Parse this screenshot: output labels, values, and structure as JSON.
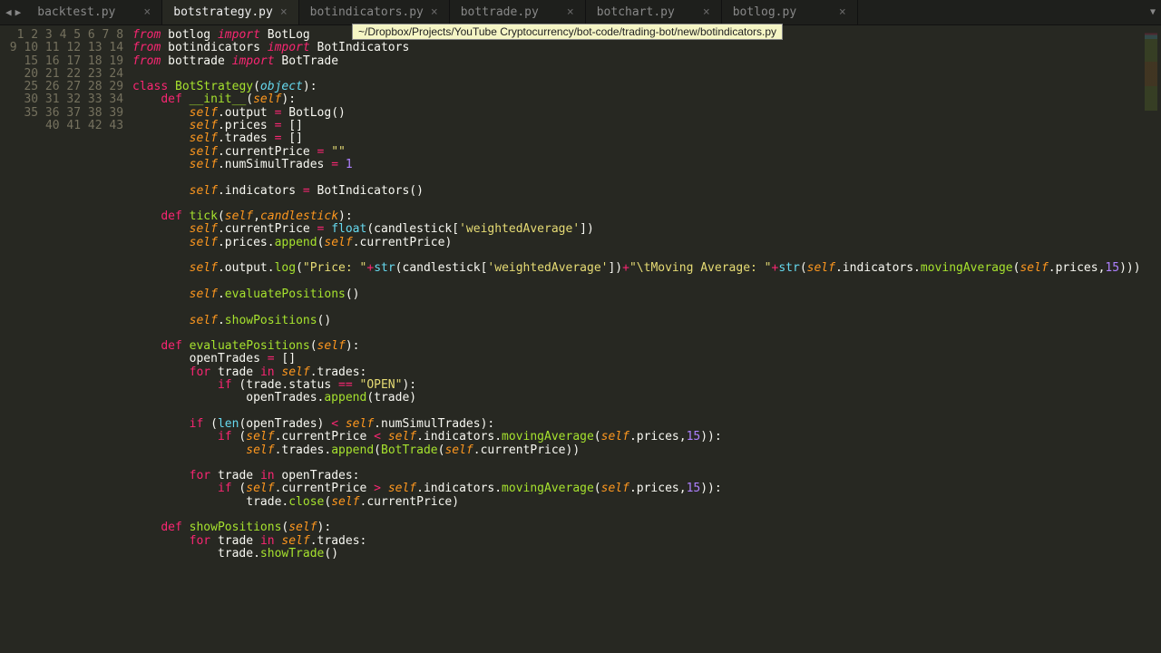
{
  "tabs": [
    {
      "label": "backtest.py",
      "active": false
    },
    {
      "label": "botstrategy.py",
      "active": true
    },
    {
      "label": "botindicators.py",
      "active": false
    },
    {
      "label": "bottrade.py",
      "active": false
    },
    {
      "label": "botchart.py",
      "active": false
    },
    {
      "label": "botlog.py",
      "active": false
    }
  ],
  "tooltip": "~/Dropbox/Projects/YouTube Cryptocurrency/bot-code/trading-bot/new/botindicators.py",
  "line_count": 43,
  "code_tokens": [
    [
      [
        "kw",
        "from"
      ],
      [
        "",
        ""
      ],
      [
        "ident",
        " botlog "
      ],
      [
        "kw",
        "import"
      ],
      [
        "ident",
        " BotLog"
      ]
    ],
    [
      [
        "kw",
        "from"
      ],
      [
        "ident",
        " botindicators "
      ],
      [
        "kw",
        "import"
      ],
      [
        "ident",
        " BotIndicators"
      ]
    ],
    [
      [
        "kw",
        "from"
      ],
      [
        "ident",
        " bottrade "
      ],
      [
        "kw",
        "import"
      ],
      [
        "ident",
        " BotTrade"
      ]
    ],
    [],
    [
      [
        "kw2",
        "class"
      ],
      [
        "ident",
        " "
      ],
      [
        "fn",
        "BotStrategy"
      ],
      [
        "ident",
        "("
      ],
      [
        "cls",
        "object"
      ],
      [
        "ident",
        "):"
      ]
    ],
    [
      [
        "ident",
        "    "
      ],
      [
        "kw2",
        "def"
      ],
      [
        "ident",
        " "
      ],
      [
        "fn",
        "__init__"
      ],
      [
        "ident",
        "("
      ],
      [
        "param",
        "self"
      ],
      [
        "ident",
        "):"
      ]
    ],
    [
      [
        "ident",
        "        "
      ],
      [
        "self",
        "self"
      ],
      [
        "ident",
        ".output "
      ],
      [
        "op",
        "="
      ],
      [
        "ident",
        " BotLog()"
      ]
    ],
    [
      [
        "ident",
        "        "
      ],
      [
        "self",
        "self"
      ],
      [
        "ident",
        ".prices "
      ],
      [
        "op",
        "="
      ],
      [
        "ident",
        " []"
      ]
    ],
    [
      [
        "ident",
        "        "
      ],
      [
        "self",
        "self"
      ],
      [
        "ident",
        ".trades "
      ],
      [
        "op",
        "="
      ],
      [
        "ident",
        " []"
      ]
    ],
    [
      [
        "ident",
        "        "
      ],
      [
        "self",
        "self"
      ],
      [
        "ident",
        ".currentPrice "
      ],
      [
        "op",
        "="
      ],
      [
        "ident",
        " "
      ],
      [
        "str",
        "\"\""
      ]
    ],
    [
      [
        "ident",
        "        "
      ],
      [
        "self",
        "self"
      ],
      [
        "ident",
        ".numSimulTrades "
      ],
      [
        "op",
        "="
      ],
      [
        "ident",
        " "
      ],
      [
        "num",
        "1"
      ]
    ],
    [],
    [
      [
        "ident",
        "        "
      ],
      [
        "self",
        "self"
      ],
      [
        "ident",
        ".indicators "
      ],
      [
        "op",
        "="
      ],
      [
        "ident",
        " BotIndicators()"
      ]
    ],
    [],
    [
      [
        "ident",
        "    "
      ],
      [
        "kw2",
        "def"
      ],
      [
        "ident",
        " "
      ],
      [
        "fn",
        "tick"
      ],
      [
        "ident",
        "("
      ],
      [
        "param",
        "self"
      ],
      [
        "ident",
        ","
      ],
      [
        "param",
        "candlestick"
      ],
      [
        "ident",
        "):"
      ]
    ],
    [
      [
        "ident",
        "        "
      ],
      [
        "self",
        "self"
      ],
      [
        "ident",
        ".currentPrice "
      ],
      [
        "op",
        "="
      ],
      [
        "ident",
        " "
      ],
      [
        "builtin",
        "float"
      ],
      [
        "ident",
        "(candlestick["
      ],
      [
        "str",
        "'weightedAverage'"
      ],
      [
        "ident",
        "])"
      ]
    ],
    [
      [
        "ident",
        "        "
      ],
      [
        "self",
        "self"
      ],
      [
        "ident",
        ".prices."
      ],
      [
        "fn",
        "append"
      ],
      [
        "ident",
        "("
      ],
      [
        "self",
        "self"
      ],
      [
        "ident",
        ".currentPrice)"
      ]
    ],
    [],
    [
      [
        "ident",
        "        "
      ],
      [
        "self",
        "self"
      ],
      [
        "ident",
        ".output."
      ],
      [
        "fn",
        "log"
      ],
      [
        "ident",
        "("
      ],
      [
        "str",
        "\"Price: \""
      ],
      [
        "op",
        "+"
      ],
      [
        "builtin",
        "str"
      ],
      [
        "ident",
        "(candlestick["
      ],
      [
        "str",
        "'weightedAverage'"
      ],
      [
        "ident",
        "])"
      ],
      [
        "op",
        "+"
      ],
      [
        "str",
        "\"\\tMoving Average: \""
      ],
      [
        "op",
        "+"
      ],
      [
        "builtin",
        "str"
      ],
      [
        "ident",
        "("
      ],
      [
        "self",
        "self"
      ],
      [
        "ident",
        ".indicators."
      ],
      [
        "fn",
        "movingAverage"
      ],
      [
        "ident",
        "("
      ],
      [
        "self",
        "self"
      ],
      [
        "ident",
        ".prices,"
      ],
      [
        "num",
        "15"
      ],
      [
        "ident",
        ")))"
      ]
    ],
    [],
    [
      [
        "ident",
        "        "
      ],
      [
        "self",
        "self"
      ],
      [
        "ident",
        "."
      ],
      [
        "fn",
        "evaluatePositions"
      ],
      [
        "ident",
        "()"
      ]
    ],
    [],
    [
      [
        "ident",
        "        "
      ],
      [
        "self",
        "self"
      ],
      [
        "ident",
        "."
      ],
      [
        "fn",
        "showPositions"
      ],
      [
        "ident",
        "()"
      ]
    ],
    [],
    [
      [
        "ident",
        "    "
      ],
      [
        "kw2",
        "def"
      ],
      [
        "ident",
        " "
      ],
      [
        "fn",
        "evaluatePositions"
      ],
      [
        "ident",
        "("
      ],
      [
        "param",
        "self"
      ],
      [
        "ident",
        "):"
      ]
    ],
    [
      [
        "ident",
        "        openTrades "
      ],
      [
        "op",
        "="
      ],
      [
        "ident",
        " []"
      ]
    ],
    [
      [
        "ident",
        "        "
      ],
      [
        "kw2",
        "for"
      ],
      [
        "ident",
        " trade "
      ],
      [
        "kw2",
        "in"
      ],
      [
        "ident",
        " "
      ],
      [
        "self",
        "self"
      ],
      [
        "ident",
        ".trades:"
      ]
    ],
    [
      [
        "ident",
        "            "
      ],
      [
        "kw2",
        "if"
      ],
      [
        "ident",
        " (trade.status "
      ],
      [
        "op",
        "=="
      ],
      [
        "ident",
        " "
      ],
      [
        "str",
        "\"OPEN\""
      ],
      [
        "ident",
        "):"
      ]
    ],
    [
      [
        "ident",
        "                openTrades."
      ],
      [
        "fn",
        "append"
      ],
      [
        "ident",
        "(trade)"
      ]
    ],
    [],
    [
      [
        "ident",
        "        "
      ],
      [
        "kw2",
        "if"
      ],
      [
        "ident",
        " ("
      ],
      [
        "builtin",
        "len"
      ],
      [
        "ident",
        "(openTrades) "
      ],
      [
        "op",
        "<"
      ],
      [
        "ident",
        " "
      ],
      [
        "self",
        "self"
      ],
      [
        "ident",
        ".numSimulTrades):"
      ]
    ],
    [
      [
        "ident",
        "            "
      ],
      [
        "kw2",
        "if"
      ],
      [
        "ident",
        " ("
      ],
      [
        "self",
        "self"
      ],
      [
        "ident",
        ".currentPrice "
      ],
      [
        "op",
        "<"
      ],
      [
        "ident",
        " "
      ],
      [
        "self",
        "self"
      ],
      [
        "ident",
        ".indicators."
      ],
      [
        "fn",
        "movingAverage"
      ],
      [
        "ident",
        "("
      ],
      [
        "self",
        "self"
      ],
      [
        "ident",
        ".prices,"
      ],
      [
        "num",
        "15"
      ],
      [
        "ident",
        ")):"
      ]
    ],
    [
      [
        "ident",
        "                "
      ],
      [
        "self",
        "self"
      ],
      [
        "ident",
        ".trades."
      ],
      [
        "fn",
        "append"
      ],
      [
        "ident",
        "("
      ],
      [
        "fn",
        "BotTrade"
      ],
      [
        "ident",
        "("
      ],
      [
        "self",
        "self"
      ],
      [
        "ident",
        ".currentPrice))"
      ]
    ],
    [],
    [
      [
        "ident",
        "        "
      ],
      [
        "kw2",
        "for"
      ],
      [
        "ident",
        " trade "
      ],
      [
        "kw2",
        "in"
      ],
      [
        "ident",
        " openTrades:"
      ]
    ],
    [
      [
        "ident",
        "            "
      ],
      [
        "kw2",
        "if"
      ],
      [
        "ident",
        " ("
      ],
      [
        "self",
        "self"
      ],
      [
        "ident",
        ".currentPrice "
      ],
      [
        "op",
        ">"
      ],
      [
        "ident",
        " "
      ],
      [
        "self",
        "self"
      ],
      [
        "ident",
        ".indicators."
      ],
      [
        "fn",
        "movingAverage"
      ],
      [
        "ident",
        "("
      ],
      [
        "self",
        "self"
      ],
      [
        "ident",
        ".prices,"
      ],
      [
        "num",
        "15"
      ],
      [
        "ident",
        ")):"
      ]
    ],
    [
      [
        "ident",
        "                trade."
      ],
      [
        "fn",
        "close"
      ],
      [
        "ident",
        "("
      ],
      [
        "self",
        "self"
      ],
      [
        "ident",
        ".currentPrice)"
      ]
    ],
    [],
    [
      [
        "ident",
        "    "
      ],
      [
        "kw2",
        "def"
      ],
      [
        "ident",
        " "
      ],
      [
        "fn",
        "showPositions"
      ],
      [
        "ident",
        "("
      ],
      [
        "param",
        "self"
      ],
      [
        "ident",
        "):"
      ]
    ],
    [
      [
        "ident",
        "        "
      ],
      [
        "kw2",
        "for"
      ],
      [
        "ident",
        " trade "
      ],
      [
        "kw2",
        "in"
      ],
      [
        "ident",
        " "
      ],
      [
        "self",
        "self"
      ],
      [
        "ident",
        ".trades:"
      ]
    ],
    [
      [
        "ident",
        "            trade."
      ],
      [
        "fn",
        "showTrade"
      ],
      [
        "ident",
        "()"
      ]
    ],
    [],
    []
  ]
}
